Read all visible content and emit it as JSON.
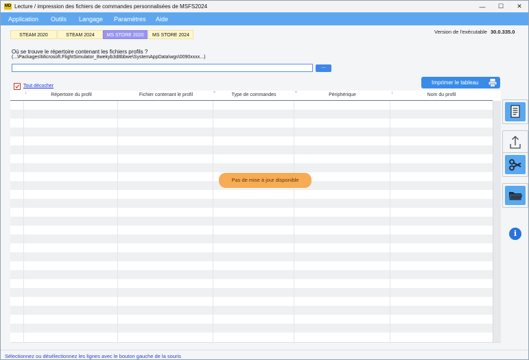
{
  "window": {
    "title": "Lecture / impression des fichiers de commandes personnalisées de MSFS2024",
    "logo_text": "MD",
    "controls": {
      "minimize": "—",
      "maximize": "☐",
      "close": "✕"
    }
  },
  "menu": {
    "items": [
      {
        "label": "Application"
      },
      {
        "label": "Outils"
      },
      {
        "label": "Langage"
      },
      {
        "label": "Paramètres"
      },
      {
        "label": "Aide"
      }
    ]
  },
  "tabs": [
    {
      "label": "STEAM 2020",
      "active": false
    },
    {
      "label": "STEAM 2024",
      "active": false
    },
    {
      "label": "MS STORE 2020",
      "active": true
    },
    {
      "label": "MS STORE 2024",
      "active": false
    }
  ],
  "version": {
    "label": "Version de l'exécutable",
    "value": "30.0.335.0"
  },
  "location": {
    "question": "Où se trouve le répertoire contenant les fichiers profils ?",
    "hint": "(...\\Packages\\Microsoft.FlightSimulator_8wekyb3d8bbwe\\SystemAppData\\wgs\\0090xxxx...)",
    "value": "",
    "browse_label": "..."
  },
  "print_button": {
    "label": "Imprimer le tableau",
    "icon": "printer-icon"
  },
  "uncheck_all": {
    "label": "Tout décocher",
    "checked": true
  },
  "grid": {
    "columns": [
      {
        "label": "Répertoire du profil",
        "sort": "↕"
      },
      {
        "label": "Fichier contenant le profil",
        "sort": "↕"
      },
      {
        "label": "Type de commandes",
        "sort": "^"
      },
      {
        "label": "Périphérique",
        "sort": "^"
      },
      {
        "label": "Nom du profil",
        "sort": "↕"
      }
    ],
    "rows": []
  },
  "toast": {
    "text": "Pas de mise à jour disponible"
  },
  "side_buttons": [
    {
      "icon": "document-list-icon"
    },
    {
      "icon": "upload-icon"
    },
    {
      "icon": "cut-icon"
    },
    {
      "icon": "folder-icon"
    },
    {
      "icon": "info-icon",
      "text": "i"
    }
  ],
  "status": {
    "text": "Sélectionnez ou désélectionnez les lignes avec le bouton gauche de la souris"
  },
  "colors": {
    "menubar": "#5ea7f0",
    "tab_active": "#9a94f0",
    "tab_inactive": "#fff7cc",
    "primary_button": "#3a8be8",
    "toast": "#f6ab54",
    "status_text": "#2a3fd6"
  }
}
